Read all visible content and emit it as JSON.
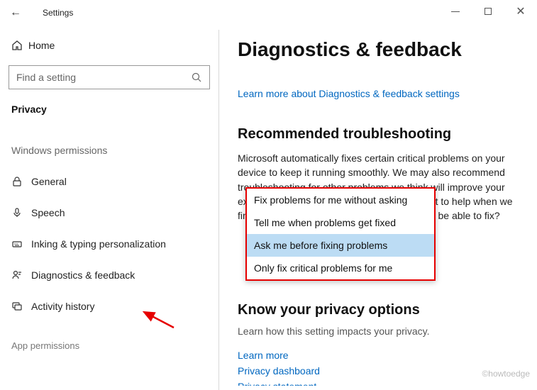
{
  "titlebar": {
    "title": "Settings"
  },
  "sidebar": {
    "home": "Home",
    "search_placeholder": "Find a setting",
    "section": "Privacy",
    "subsection": "Windows permissions",
    "items": [
      {
        "label": "General"
      },
      {
        "label": "Speech"
      },
      {
        "label": "Inking & typing personalization"
      },
      {
        "label": "Diagnostics & feedback"
      },
      {
        "label": "Activity history"
      }
    ],
    "app_perm": "App permissions"
  },
  "main": {
    "heading": "Diagnostics & feedback",
    "learn_link": "Learn more about Diagnostics & feedback settings",
    "rec_heading": "Recommended troubleshooting",
    "rec_body": "Microsoft automatically fixes certain critical problems on your device to keep it running smoothly. We may also recommend troubleshooting for other problems we think will improve your experience. How much do you want Microsoft to help when we find other issues on this device that we might be able to fix?",
    "dropdown": {
      "options": [
        "Fix problems for me without asking",
        "Tell me when problems get fixed",
        "Ask me before fixing problems",
        "Only fix critical problems for me"
      ],
      "selected_index": 2
    },
    "privacy_heading": "Know your privacy options",
    "privacy_sub": "Learn how this setting impacts your privacy.",
    "links": {
      "learn": "Learn more",
      "dashboard": "Privacy dashboard",
      "statement": "Privacy statement"
    }
  },
  "watermark": "©howtoedge"
}
